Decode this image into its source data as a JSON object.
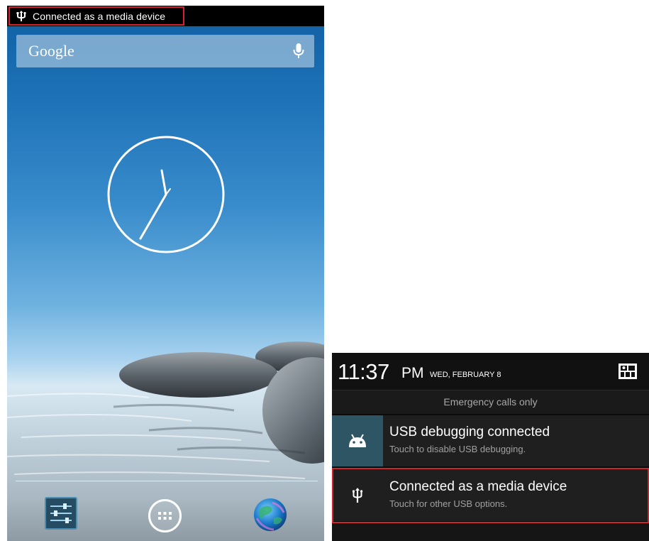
{
  "home": {
    "status_text": "Connected as a media device",
    "search_brand": "Google",
    "icons": {
      "status": "usb-icon",
      "mic": "mic-icon",
      "settings": "settings-sliders-icon",
      "apps": "app-drawer-icon",
      "browser": "globe-browser-icon"
    }
  },
  "shade": {
    "time": "11:37",
    "ampm": "PM",
    "date": "WED, FEBRUARY 8",
    "carrier": "Emergency calls only",
    "notifications": [
      {
        "title": "USB debugging connected",
        "subtitle": "Touch to disable USB debugging.",
        "icon": "android-icon"
      },
      {
        "title": "Connected as a media device",
        "subtitle": "Touch for other USB options.",
        "icon": "usb-icon"
      }
    ],
    "quick_settings_icon": "quick-settings-icon"
  },
  "colors": {
    "highlight": "#d0232b",
    "debug_icon_bg": "#2e5563",
    "sky_top": "#0f5fa2"
  }
}
